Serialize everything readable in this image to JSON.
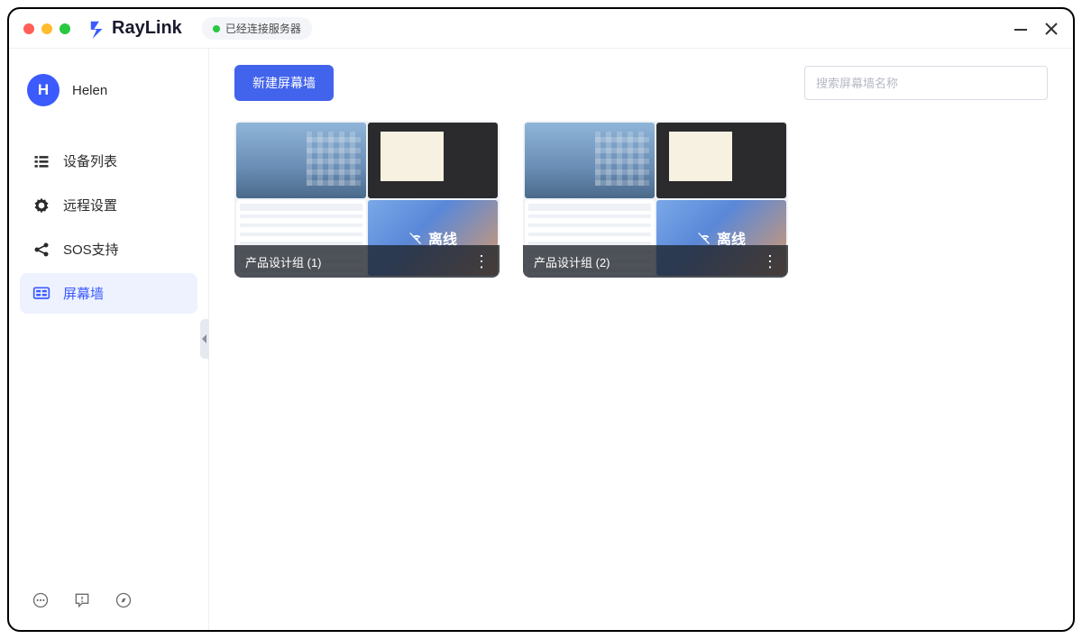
{
  "app": {
    "name": "RayLink",
    "status_text": "已经连接服务器"
  },
  "user": {
    "name": "Helen",
    "initial": "H"
  },
  "sidebar": {
    "items": [
      {
        "label": "设备列表"
      },
      {
        "label": "远程设置"
      },
      {
        "label": "SOS支持"
      },
      {
        "label": "屏幕墙"
      }
    ]
  },
  "toolbar": {
    "create_label": "新建屏幕墙",
    "search_placeholder": "搜索屏幕墙名称"
  },
  "cards": [
    {
      "title": "产品设计组 (1)",
      "offline_label": "离线"
    },
    {
      "title": "产品设计组 (2)",
      "offline_label": "离线"
    }
  ]
}
